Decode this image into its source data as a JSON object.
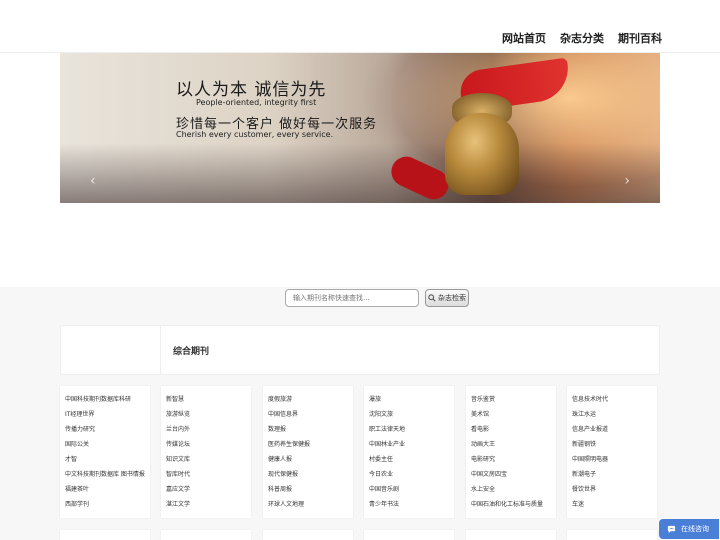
{
  "nav": [
    "网站首页",
    "杂志分类",
    "期刊百科"
  ],
  "banner": {
    "line1": "以人为本 诚信为先",
    "line2": "People-oriented, integrity first",
    "line3": "珍惜每一个客户 做好每一次服务",
    "line4": "Cherish every customer, every service."
  },
  "search": {
    "placeholder": "输入期刊名称快速查找...",
    "button": "杂志检索"
  },
  "section_title": "综合期刊",
  "columns": [
    [
      "中国科技期刊数据库科研",
      "IT经理世界",
      "传播力研究",
      "国际公关",
      "才智",
      "中文科技期刊数据库 图书情报",
      "福建茶叶",
      "西部学刊"
    ],
    [
      "新智慧",
      "旅游纵览",
      "兰台内外",
      "传媒论坛",
      "知识文库",
      "智库时代",
      "嘉应文学",
      "湛江文学"
    ],
    [
      "度假旅游",
      "中国信息界",
      "数理报",
      "医药养生保健报",
      "健康人报",
      "现代保健报",
      "科普周报",
      "环球人文地理"
    ],
    [
      "瀑旅",
      "沈阳文旅",
      "职工法律天地",
      "中国林业产业",
      "村委主任",
      "今日农业",
      "中国音乐剧",
      "青少年书法"
    ],
    [
      "音乐鉴赏",
      "美术馆",
      "看电影",
      "动画大王",
      "电影研究",
      "中国文房四宝",
      "水上安全",
      "中国石油和化工标准与质量"
    ],
    [
      "信息技术时代",
      "珠江水运",
      "信息产业报道",
      "新疆钢铁",
      "中国照明电器",
      "新潮电子",
      "餐饮世界",
      "车迷"
    ]
  ],
  "chat_label": "在线咨询"
}
